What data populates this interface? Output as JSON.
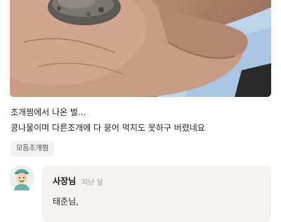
{
  "review": {
    "lines": [
      "조개찜에서 나온 벌...",
      "콩나물이며 다른조개에 다 묻어 먹지도 못하구 버렸네요"
    ],
    "tag": "모듬조개찜"
  },
  "reply": {
    "author": "사장님",
    "time": "지난 달",
    "body": "태준님,"
  }
}
